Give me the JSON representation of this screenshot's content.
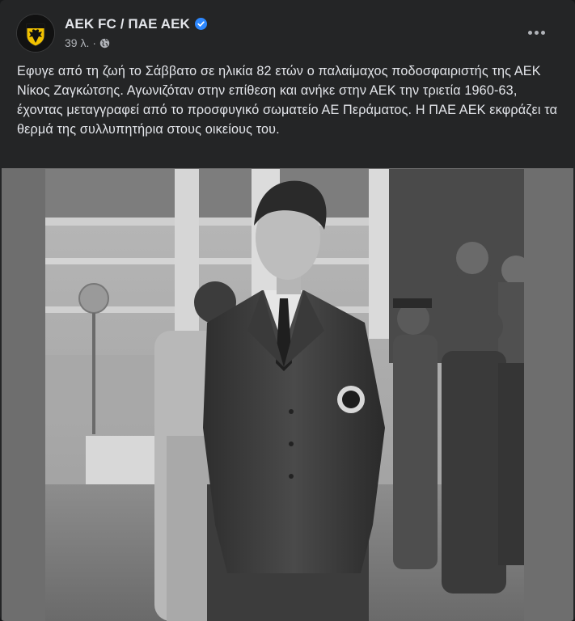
{
  "post": {
    "page_name": "AEK FC / ΠΑΕ ΑΕΚ",
    "timestamp": "39 λ.",
    "separator": "·",
    "verified_icon": "verified-badge-icon",
    "audience_icon": "globe-icon",
    "more_icon": "more-options-icon",
    "text": "Εφυγε από τη ζωή το Σάββατο σε ηλικία 82 ετών ο παλαίμαχος ποδοσφαιριστής της ΑΕΚ Νίκος Ζαγκώτσης. Αγωνιζόταν στην επίθεση και ανήκε στην ΑΕΚ την τριετία 1960-63, έχοντας μεταγγραφεί από το προσφυγικό σωματείο ΑΕ Περάματος. Η ΠΑΕ ΑΕΚ εκφράζει τα θερμά της συλλυπητήρια στους οικείους του."
  },
  "colors": {
    "card_background": "#242526",
    "primary_text": "#e4e6eb",
    "secondary_text": "#b0b3b8",
    "verified_blue": "#2d88ff",
    "logo_yellow": "#f2c200"
  }
}
